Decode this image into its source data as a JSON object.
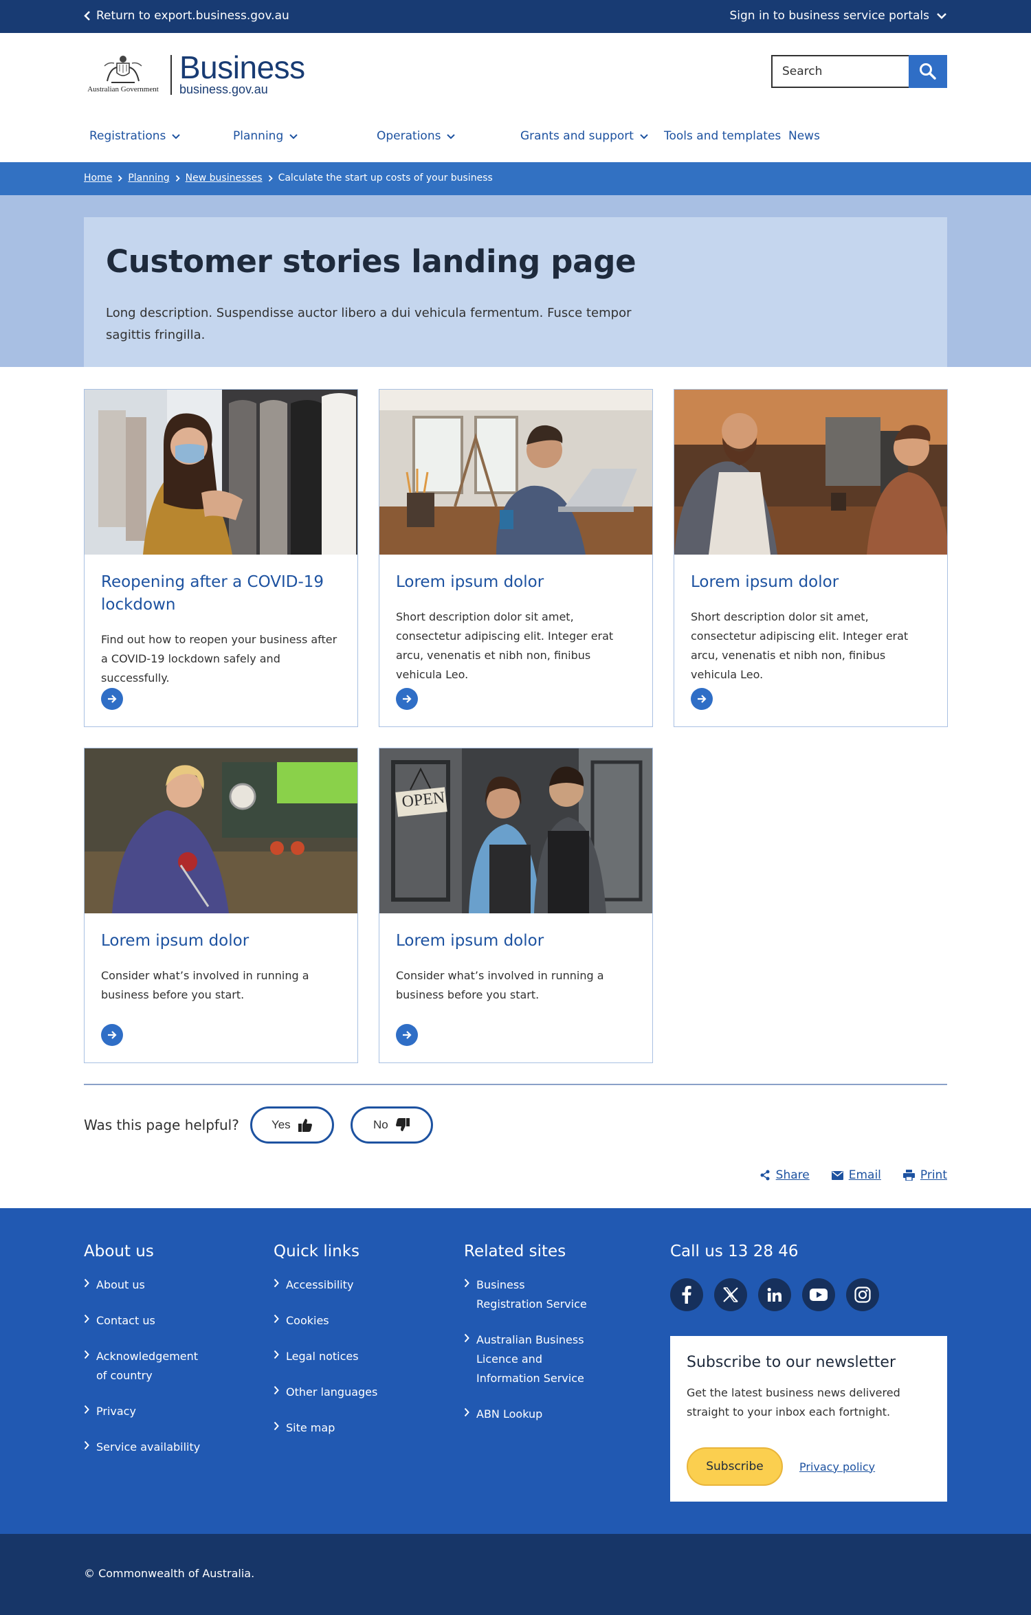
{
  "topbar": {
    "back_label": "Return to export.business.gov.au",
    "signin_label": "Sign in to business service portals"
  },
  "header": {
    "govt_label": "Australian Government",
    "brand_name": "Business",
    "brand_url": "business.gov.au",
    "search_placeholder": "Search"
  },
  "nav": {
    "items": [
      {
        "label": "Registrations",
        "dropdown": true
      },
      {
        "label": "Planning",
        "dropdown": true
      },
      {
        "label": "Operations",
        "dropdown": true
      },
      {
        "label": "Grants and support",
        "dropdown": true
      },
      {
        "label": "Tools and templates",
        "dropdown": false
      },
      {
        "label": "News",
        "dropdown": false
      }
    ]
  },
  "breadcrumb": {
    "items": [
      "Home",
      "Planning",
      "New businesses"
    ],
    "current": "Calculate the start up costs of your business"
  },
  "hero": {
    "title": "Customer stories landing page",
    "description": "Long description. Suspendisse auctor libero a dui vehicula fermentum. Fusce tempor sagittis fringilla."
  },
  "cards": [
    {
      "title": "Reopening after a COVID-19 lockdown",
      "text": "Find out how to reopen your business after a COVID-19 lockdown safely and successfully.",
      "image": "woman-in-mask-clothing-store"
    },
    {
      "title": "Lorem ipsum dolor",
      "text": "Short description dolor sit amet, consectetur adipiscing elit. Integer erat arcu, venenatis et nibh non, finibus vehicula Leo.",
      "image": "man-at-laptop-studio"
    },
    {
      "title": "Lorem ipsum dolor",
      "text": "Short description dolor sit amet, consectetur adipiscing elit. Integer erat arcu, venenatis et nibh non, finibus vehicula Leo.",
      "image": "barista-and-customer-cafe"
    },
    {
      "title": "Lorem ipsum dolor",
      "text": "Consider what’s involved in running a business before you start.",
      "image": "woman-in-workshop"
    },
    {
      "title": "Lorem ipsum dolor",
      "text": "Consider what’s involved in running a business before you start.",
      "image": "couple-with-open-sign",
      "sign_text": "OPEN"
    }
  ],
  "feedback": {
    "question": "Was this page helpful?",
    "yes_label": "Yes",
    "no_label": "No"
  },
  "share": {
    "share_label": "Share",
    "email_label": "Email",
    "print_label": "Print"
  },
  "footer": {
    "about": {
      "heading": "About us",
      "links": [
        [
          "About us"
        ],
        [
          "Contact us"
        ],
        [
          "Acknowledgement",
          "of country"
        ],
        [
          "Privacy"
        ],
        [
          "Service availability"
        ]
      ]
    },
    "quick": {
      "heading": "Quick links",
      "links": [
        [
          "Accessibility"
        ],
        [
          "Cookies"
        ],
        [
          "Legal notices"
        ],
        [
          "Other languages"
        ],
        [
          "Site map"
        ]
      ]
    },
    "related": {
      "heading": "Related sites",
      "links": [
        [
          "Business",
          "Registration Service"
        ],
        [
          "Australian Business",
          "Licence and",
          "Information Service"
        ],
        [
          "ABN Lookup"
        ]
      ]
    },
    "call": "Call us 13 28 46",
    "social": [
      "facebook-icon",
      "x-icon",
      "linkedin-icon",
      "youtube-icon",
      "instagram-icon"
    ],
    "newsletter": {
      "heading": "Subscribe to our newsletter",
      "text": "Get the latest business news delivered straight to your inbox each fortnight.",
      "subscribe_label": "Subscribe",
      "privacy_label": "Privacy policy"
    }
  },
  "copyright": "© Commonwealth of Australia.",
  "colors": {
    "topbar": "#183b73",
    "brand_blue": "#1d52a0",
    "breadcrumb_bar": "#3271c2",
    "hero_bg": "#c5d6ee",
    "footer": "#2159b2",
    "copyright_bar": "#173668",
    "subscribe_yellow": "#fbcf4f"
  }
}
